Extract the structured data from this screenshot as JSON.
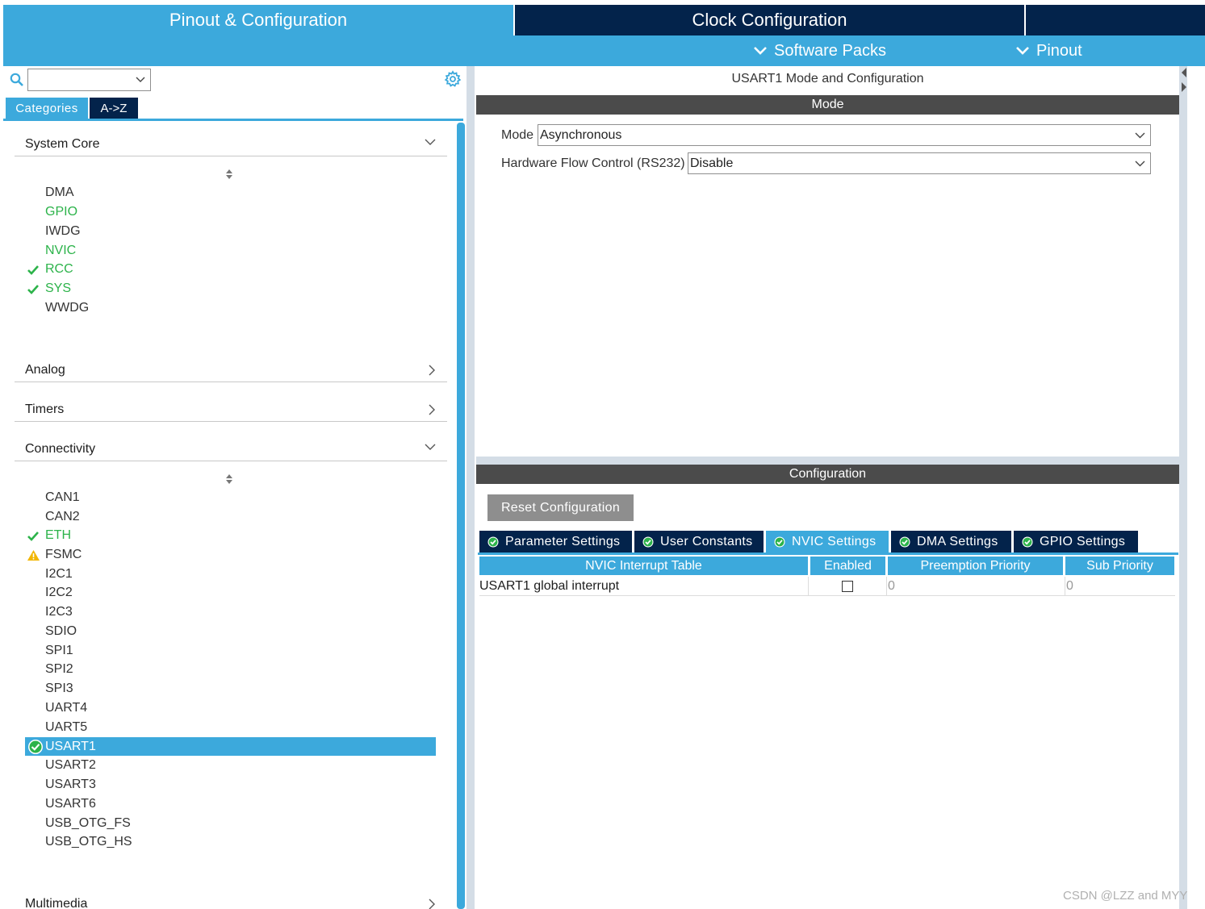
{
  "header": {
    "tabs": [
      {
        "label": "Pinout & Configuration",
        "active": true
      },
      {
        "label": "Clock Configuration",
        "active": false
      }
    ],
    "sub_items": [
      {
        "label": "Software Packs",
        "icon": "chevron-down-icon"
      },
      {
        "label": "Pinout",
        "icon": "chevron-down-icon"
      }
    ]
  },
  "left_panel": {
    "search": {
      "value": ""
    },
    "view_tabs": [
      "Categories",
      "A->Z"
    ],
    "categories": [
      {
        "name": "System Core",
        "expanded": true,
        "items": [
          {
            "label": "DMA",
            "status": "none"
          },
          {
            "label": "GPIO",
            "status": "configured"
          },
          {
            "label": "IWDG",
            "status": "none"
          },
          {
            "label": "NVIC",
            "status": "configured"
          },
          {
            "label": "RCC",
            "status": "checked"
          },
          {
            "label": "SYS",
            "status": "checked"
          },
          {
            "label": "WWDG",
            "status": "none"
          }
        ]
      },
      {
        "name": "Analog",
        "expanded": false
      },
      {
        "name": "Timers",
        "expanded": false
      },
      {
        "name": "Connectivity",
        "expanded": true,
        "items": [
          {
            "label": "CAN1",
            "status": "none"
          },
          {
            "label": "CAN2",
            "status": "none"
          },
          {
            "label": "ETH",
            "status": "checked"
          },
          {
            "label": "FSMC",
            "status": "warning"
          },
          {
            "label": "I2C1",
            "status": "none"
          },
          {
            "label": "I2C2",
            "status": "none"
          },
          {
            "label": "I2C3",
            "status": "none"
          },
          {
            "label": "SDIO",
            "status": "none"
          },
          {
            "label": "SPI1",
            "status": "none"
          },
          {
            "label": "SPI2",
            "status": "none"
          },
          {
            "label": "SPI3",
            "status": "none"
          },
          {
            "label": "UART4",
            "status": "none"
          },
          {
            "label": "UART5",
            "status": "none"
          },
          {
            "label": "USART1",
            "status": "selected"
          },
          {
            "label": "USART2",
            "status": "none"
          },
          {
            "label": "USART3",
            "status": "none"
          },
          {
            "label": "USART6",
            "status": "none"
          },
          {
            "label": "USB_OTG_FS",
            "status": "none"
          },
          {
            "label": "USB_OTG_HS",
            "status": "none"
          }
        ]
      },
      {
        "name": "Multimedia",
        "expanded": false
      }
    ]
  },
  "right_panel": {
    "title": "USART1 Mode and Configuration",
    "mode_header": "Mode",
    "mode_fields": [
      {
        "label": "Mode",
        "value": "Asynchronous"
      },
      {
        "label": "Hardware Flow Control (RS232)",
        "value": "Disable"
      }
    ],
    "config_header": "Configuration",
    "reset_button": "Reset Configuration",
    "config_tabs": [
      {
        "label": "Parameter Settings",
        "active": false
      },
      {
        "label": "User Constants",
        "active": false
      },
      {
        "label": "NVIC Settings",
        "active": true
      },
      {
        "label": "DMA Settings",
        "active": false
      },
      {
        "label": "GPIO Settings",
        "active": false
      }
    ],
    "nvic_table": {
      "columns": [
        "NVIC Interrupt Table",
        "Enabled",
        "Preemption Priority",
        "Sub Priority"
      ],
      "rows": [
        {
          "name": "USART1 global interrupt",
          "enabled": false,
          "preemption": "0",
          "sub": "0"
        }
      ]
    }
  },
  "watermark": "CSDN @LZZ and MYY",
  "colors": {
    "accent_blue": "#3ca9dc",
    "navy": "#03234b",
    "dark_bar": "#4b4b4b",
    "green": "#2cb34a",
    "warning": "#f2b600"
  }
}
